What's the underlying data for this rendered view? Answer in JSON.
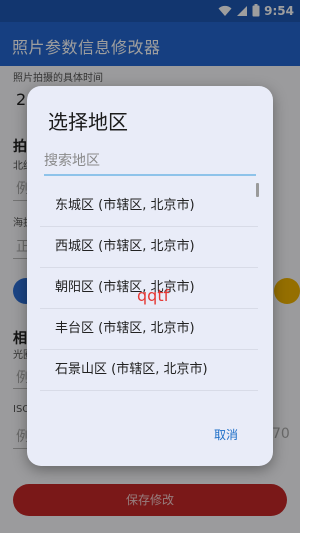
{
  "status_bar": {
    "time": "9:54",
    "icons": [
      "wifi-icon",
      "signal-icon",
      "battery-icon"
    ]
  },
  "app_bar": {
    "title": "照片参数信息修改器"
  },
  "form": {
    "datetime_label": "照片拍摄的具体时间",
    "datetime_value": "20",
    "section1_title": "拍",
    "section1_label": "北纬",
    "section1_hint": "例",
    "altitude_label": "海拔",
    "altitude_hint": "正",
    "section2_title": "相",
    "section2_label": "光圈",
    "section2_hint": "例",
    "iso_label": "ISO",
    "iso_hint": "例",
    "iso_right_hint": "70",
    "save_button": "保存修改"
  },
  "dialog": {
    "title": "选择地区",
    "search_placeholder": "搜索地区",
    "items": [
      "东城区 (市辖区, 北京市)",
      "西城区 (市辖区, 北京市)",
      "朝阳区 (市辖区, 北京市)",
      "丰台区 (市辖区, 北京市)",
      "石景山区 (市辖区, 北京市)"
    ],
    "cancel_button": "取消",
    "overlay_text": "qqtf"
  },
  "colors": {
    "status_bar": "#1e58b4",
    "app_bar": "#2466d0",
    "dialog_bg": "#e9ecf8",
    "accent_blue": "#1e6fc8",
    "save_button": "#c62828",
    "overlay_text": "#e53935"
  }
}
